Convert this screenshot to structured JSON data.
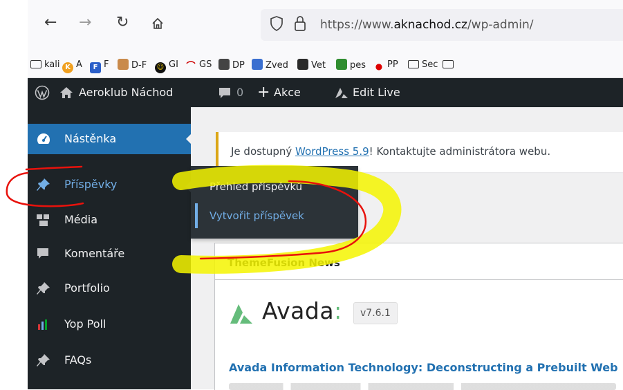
{
  "browser": {
    "url_prefix": "https://www.",
    "url_domain": "aknachod.cz",
    "url_path": "/wp-admin/",
    "bookmarks": [
      {
        "label": "kali",
        "icon": "folder"
      },
      {
        "label": "A",
        "icon": "k-orange"
      },
      {
        "label": "F",
        "icon": "f-blue"
      },
      {
        "label": "D-F",
        "icon": "photo"
      },
      {
        "label": "GI",
        "icon": "smiley"
      },
      {
        "label": "GS",
        "icon": "wave"
      },
      {
        "label": "DP",
        "icon": "dark"
      },
      {
        "label": "Zved",
        "icon": "blue-flag"
      },
      {
        "label": "Vet",
        "icon": "vet"
      },
      {
        "label": "pes",
        "icon": "green"
      },
      {
        "label": "PP",
        "icon": "red"
      },
      {
        "label": "Sec",
        "icon": "folder"
      }
    ]
  },
  "adminbar": {
    "site_name": "Aeroklub Náchod",
    "comments_count": "0",
    "new_label": "Akce",
    "edit_live_label": "Edit Live"
  },
  "sidebar": {
    "items": [
      {
        "label": "Nástěnka",
        "icon": "dashboard-icon"
      },
      {
        "label": "Příspěvky",
        "icon": "pin-icon"
      },
      {
        "label": "Média",
        "icon": "media-icon"
      },
      {
        "label": "Komentáře",
        "icon": "comment-icon"
      },
      {
        "label": "Portfolio",
        "icon": "pin-icon"
      },
      {
        "label": "Yop Poll",
        "icon": "poll-icon"
      },
      {
        "label": "FAQs",
        "icon": "pin-icon"
      }
    ]
  },
  "flyout": {
    "items": [
      {
        "label": "Přehled příspěvků"
      },
      {
        "label": "Vytvořit příspěvek"
      }
    ]
  },
  "notice": {
    "prefix": "Je dostupný ",
    "link": "WordPress 5.9",
    "suffix": "! Kontaktujte administrátora webu."
  },
  "widget": {
    "title": "ThemeFusion News",
    "brand": "Avada",
    "version": "v7.6.1",
    "news_title": "Avada Information Technology: Deconstructing a Prebuilt Web"
  },
  "colors": {
    "admin_dark": "#1d2327",
    "wp_blue": "#2271b1",
    "link_hover": "#72aee6",
    "notice_warning": "#dba617",
    "annotation_red": "#e8120c",
    "annotation_yellow": "#f5f500"
  }
}
